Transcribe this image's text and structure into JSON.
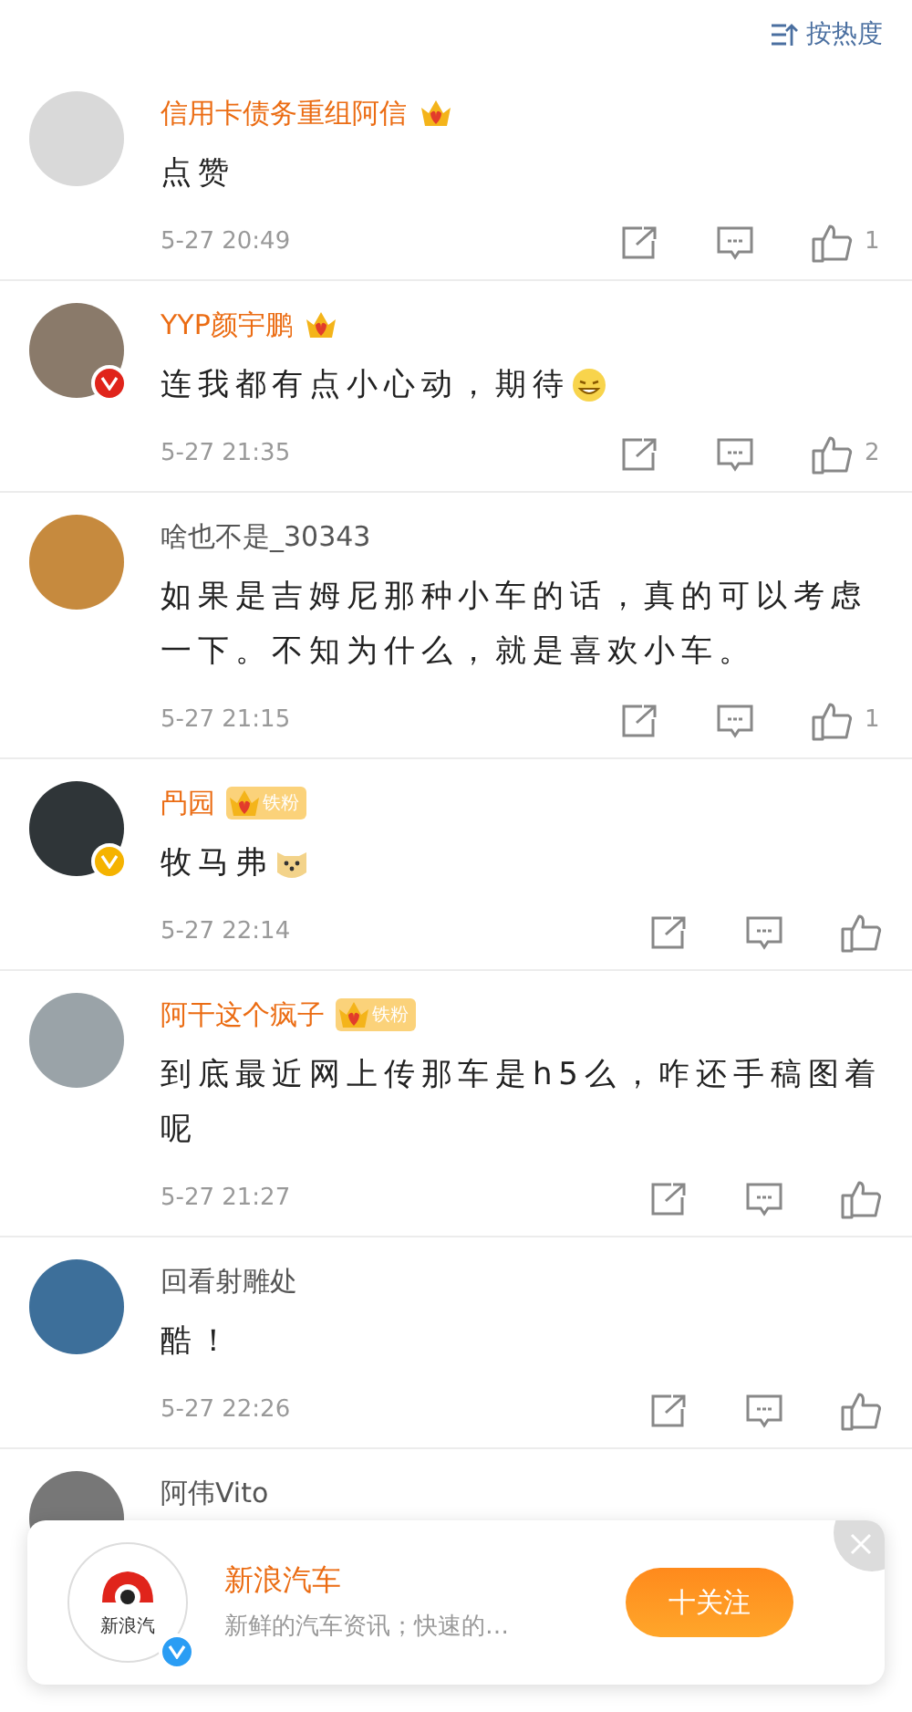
{
  "sort_button": {
    "label": "按热度"
  },
  "comments": [
    {
      "name": "信用卡债务重组阿信",
      "member": true,
      "crown": true,
      "text": "点赞",
      "time": "5-27 20:49",
      "likes": "1"
    },
    {
      "name": "YYP颜宇鹏",
      "member": true,
      "crown": true,
      "verified": {
        "color": "#e0241b"
      },
      "text": "连我都有点小心动，期待",
      "emoji": {
        "kind": "grin"
      },
      "time": "5-27 21:35",
      "likes": "2"
    },
    {
      "name": "啥也不是_30343",
      "member": false,
      "crown": false,
      "text": "如果是吉姆尼那种小车的话，真的可以考虑一下。不知为什么，就是喜欢小车。",
      "time": "5-27 21:15",
      "likes": "1"
    },
    {
      "name": "冎园",
      "member": true,
      "crown": true,
      "fan_label": "铁粉",
      "verified": {
        "color": "#f5b300"
      },
      "text": "牧马弗",
      "emoji": {
        "kind": "doge"
      },
      "time": "5-27 22:14"
    },
    {
      "name": "阿干这个疯子",
      "member": true,
      "crown": true,
      "fan_label": "铁粉",
      "text": "到底最近网上传那车是h5么，咋还手稿图着呢",
      "time": "5-27 21:27"
    },
    {
      "name": "回看射雕处",
      "member": false,
      "crown": false,
      "text": "酷！",
      "time": "5-27 22:26"
    },
    {
      "name": "阿伟Vito",
      "member": false,
      "crown": false
    }
  ],
  "follow_card": {
    "logo_text": "新浪汽",
    "title": "新浪汽车",
    "description": "新鲜的汽车资讯；快速的…",
    "follow_button": "十关注"
  }
}
